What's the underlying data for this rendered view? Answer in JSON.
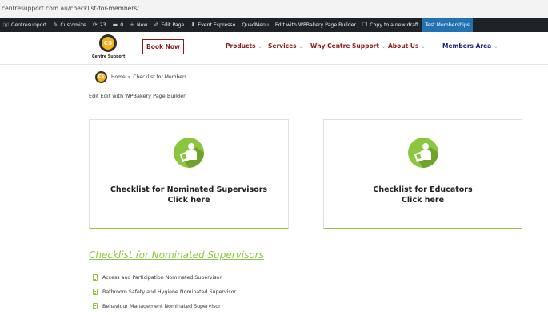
{
  "browser": {
    "url": "centresupport.com.au/checklist-for-members/"
  },
  "admin_bar": {
    "items": [
      {
        "label": "Centresupport",
        "icon": "wordpress-icon"
      },
      {
        "label": "Customize",
        "icon": "pencil-icon"
      },
      {
        "label": "23",
        "icon": "refresh-icon"
      },
      {
        "label": "0",
        "icon": "comment-icon"
      },
      {
        "label": "New",
        "icon": "plus-icon"
      },
      {
        "label": "Edit Page",
        "icon": "edit-icon"
      },
      {
        "label": "Event Espresso",
        "icon": "ticket-icon"
      },
      {
        "label": "QuadMenu",
        "icon": ""
      },
      {
        "label": "Edit with WPBakery Page Builder",
        "icon": ""
      },
      {
        "label": "Copy to a new draft",
        "icon": "copy-icon"
      },
      {
        "label": "Test Memberships",
        "icon": ""
      }
    ]
  },
  "header": {
    "logo_initials": "CS",
    "logo_text": "Centre Support",
    "book_now": "Book Now",
    "nav": [
      {
        "label": "Products"
      },
      {
        "label": "Services"
      },
      {
        "label": "Why Centre Support"
      },
      {
        "label": "About Us"
      },
      {
        "label": "Members Area"
      }
    ],
    "chevron": "⌄"
  },
  "breadcrumb": {
    "home": "Home",
    "sep": "»",
    "current": "Checklist for Members"
  },
  "edit_line": "Edit Edit with WPBakery Page Builder",
  "cards": [
    {
      "line1": "Checklist for Nominated Supervisors",
      "line2": "Click here"
    },
    {
      "line1": "Checklist for Educators",
      "line2": "Click here"
    }
  ],
  "section_title": "Checklist for Nominated Supervisors",
  "list_items": [
    "Access and Participation Nominated Supervisor",
    "Bathroom Safety and Hygiene Nominated Supervisor",
    "Behaviour Management Nominated Supervisor"
  ],
  "colors": {
    "accent_green": "#8cc63f",
    "brand_red": "#8b1a1a",
    "brand_navy": "#1a237e",
    "admin_bar": "#1d2327",
    "logo_gold": "#f5b21a"
  }
}
